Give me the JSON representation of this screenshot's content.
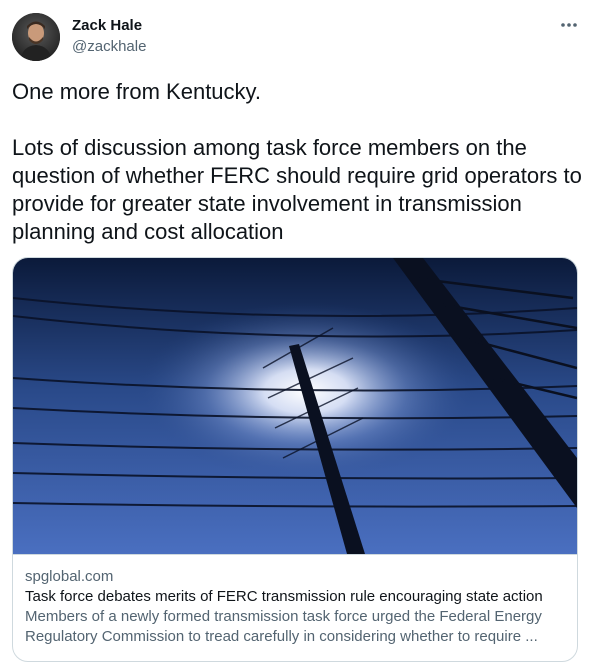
{
  "author": {
    "name": "Zack Hale",
    "handle": "@zackhale"
  },
  "icons": {
    "more": "more-horizontal-icon",
    "avatar": "profile-photo"
  },
  "tweet": {
    "line1": "One more from Kentucky.",
    "line2": "Lots of discussion among task force members on the question of whether FERC should require grid operators to provide for greater state involvement in transmission planning and cost allocation"
  },
  "card": {
    "domain": "spglobal.com",
    "title": "Task force debates merits of FERC transmission rule encouraging state action",
    "description_line1": "Members of a newly formed transmission task force urged the Federal Energy",
    "description_line2": "Regulatory Commission to tread carefully in considering whether to require ..."
  },
  "colors": {
    "text": "#0f1419",
    "secondary": "#536471",
    "border": "#cfd9de"
  }
}
